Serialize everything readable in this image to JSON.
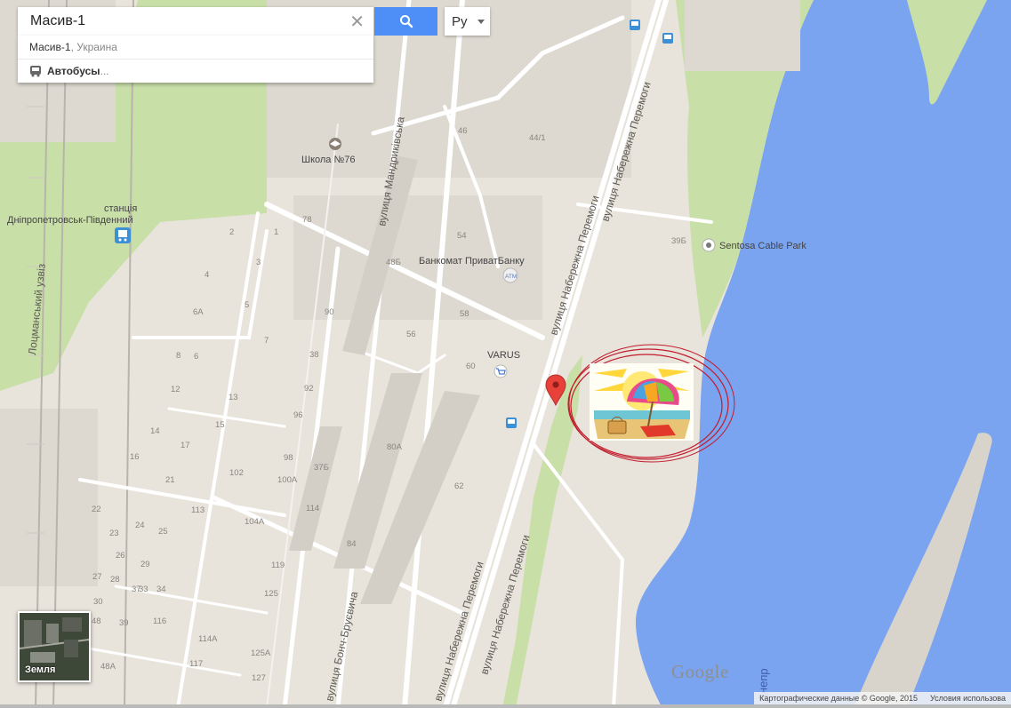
{
  "search": {
    "value": "Масив-1",
    "clear_icon": "close-icon",
    "button_icon": "search-icon",
    "button_color": "#4d8ef7"
  },
  "language": {
    "label": "Ру"
  },
  "suggestions": [
    {
      "main": "Масив-1",
      "sub": ", Украина"
    },
    {
      "main": "Автобусы",
      "sub": "...",
      "icon": "bus-icon"
    }
  ],
  "map": {
    "colors": {
      "water": "#7aa3f0",
      "park": "#c9dfa8",
      "land": "#e8e4dc",
      "road": "#ffffff"
    },
    "streets": [
      "вулиця Набережна Перемоги",
      "вулиця Набережна Перемоги",
      "вулиця Набережна Перемоги",
      "вулиця Набережна Перемоги",
      "вулиця Мандриківська",
      "Лоцманський узвіз",
      "вулиця Бонч-Бруєвича"
    ],
    "pois": {
      "school": "Школа №76",
      "station_line1": "станція",
      "station_line2": "Дніпропетровськ-Південний",
      "atm": "Банкомат ПриватБанку",
      "atm_badge": "ATM",
      "varus": "VARUS",
      "sentosa": "Sentosa Cable Park"
    },
    "water_label": "Днепр",
    "house_numbers": [
      "46",
      "44/1",
      "78",
      "1",
      "2",
      "3",
      "4",
      "5",
      "6А",
      "7",
      "8",
      "6",
      "12",
      "13",
      "14",
      "15",
      "16",
      "17",
      "21",
      "22",
      "23",
      "24",
      "25",
      "26",
      "27",
      "28",
      "29",
      "30",
      "33",
      "34",
      "37",
      "38",
      "39",
      "48",
      "48А",
      "48Б",
      "54",
      "56",
      "58",
      "60",
      "62",
      "80А",
      "84",
      "90",
      "92",
      "96",
      "98",
      "100А",
      "102",
      "104А",
      "113",
      "114",
      "114А",
      "116",
      "117",
      "119",
      "125",
      "125А",
      "127",
      "37Б",
      "39Б"
    ]
  },
  "earth_button": {
    "label": "Земля"
  },
  "google_logo": "Google",
  "copyright": {
    "data": "Картографические данные © Google, 2015",
    "terms": "Условия использова"
  }
}
